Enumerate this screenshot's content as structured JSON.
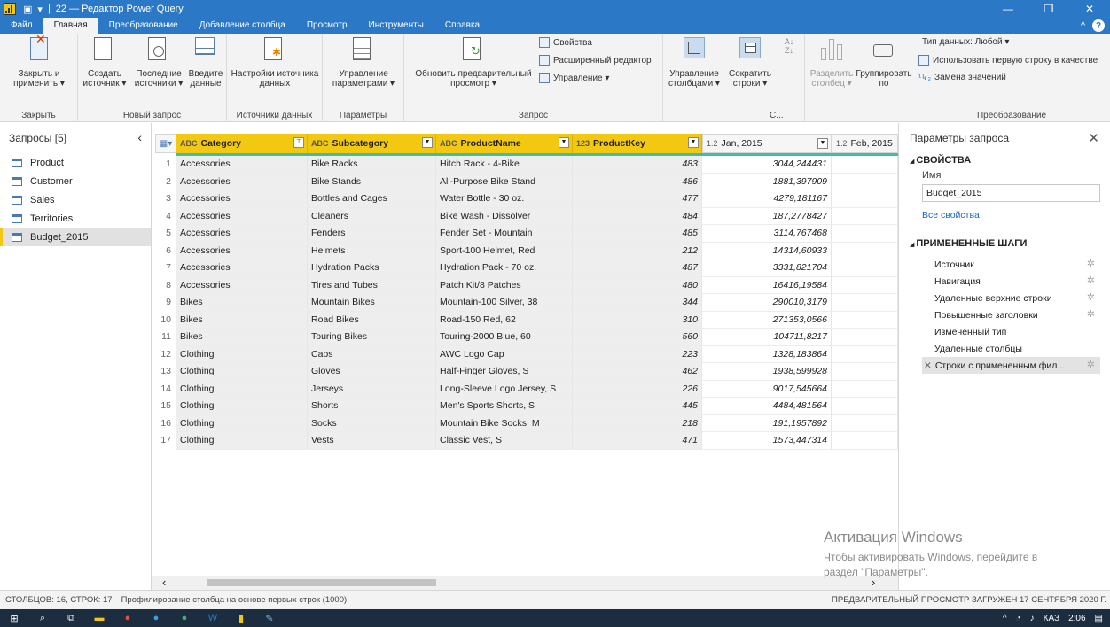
{
  "window": {
    "title": "22 — Редактор Power Query",
    "controls": [
      "—",
      "❐",
      "✕"
    ]
  },
  "menu_tabs": [
    "Файл",
    "Главная",
    "Преобразование",
    "Добавление столбца",
    "Просмотр",
    "Инструменты",
    "Справка"
  ],
  "ribbon": {
    "close_apply": "Закрыть и применить ▾",
    "close_group": "Закрыть",
    "new_source": "Создать источник ▾",
    "recent_sources": "Последние источники ▾",
    "enter_data": "Введите данные",
    "new_query_group": "Новый запрос",
    "datasource_settings": "Настройки источника данных",
    "datasources_group": "Источники данных",
    "manage_params": "Управление параметрами ▾",
    "params_group": "Параметры",
    "refresh_preview": "Обновить предварительный просмотр ▾",
    "properties": "Свойства",
    "advanced_editor": "Расширенный редактор",
    "manage": "Управление ▾",
    "query_group": "Запрос",
    "manage_columns": "Управление столбцами ▾",
    "reduce_rows": "Сократить строки ▾",
    "sort_group_label": "С...",
    "split_column": "Разделить столбец ▾",
    "group_by": "Группировать по",
    "data_type": "Тип данных: Любой ▾",
    "use_first_row": "Использовать первую строку в качестве",
    "replace_values": "Замена значений",
    "transform_group": "Преобразование"
  },
  "queries_panel": {
    "header": "Запросы [5]",
    "items": [
      "Product",
      "Customer",
      "Sales",
      "Territories",
      "Budget_2015"
    ],
    "selected": "Budget_2015"
  },
  "grid": {
    "columns": [
      {
        "type": "ABC",
        "name": "Category"
      },
      {
        "type": "ABC",
        "name": "Subcategory"
      },
      {
        "type": "ABC",
        "name": "ProductName"
      },
      {
        "type": "123",
        "name": "ProductKey"
      },
      {
        "type": "1.2",
        "name": "Jan, 2015"
      },
      {
        "type": "1.2",
        "name": "Feb, 2015"
      }
    ],
    "rows": [
      [
        "1",
        "Accessories",
        "Bike Racks",
        "Hitch Rack - 4-Bike",
        "483",
        "3044,244431"
      ],
      [
        "2",
        "Accessories",
        "Bike Stands",
        "All-Purpose Bike Stand",
        "486",
        "1881,397909"
      ],
      [
        "3",
        "Accessories",
        "Bottles and Cages",
        "Water Bottle - 30 oz.",
        "477",
        "4279,181167"
      ],
      [
        "4",
        "Accessories",
        "Cleaners",
        "Bike Wash - Dissolver",
        "484",
        "187,2778427"
      ],
      [
        "5",
        "Accessories",
        "Fenders",
        "Fender Set - Mountain",
        "485",
        "3114,767468"
      ],
      [
        "6",
        "Accessories",
        "Helmets",
        "Sport-100 Helmet, Red",
        "212",
        "14314,60933"
      ],
      [
        "7",
        "Accessories",
        "Hydration Packs",
        "Hydration Pack - 70 oz.",
        "487",
        "3331,821704"
      ],
      [
        "8",
        "Accessories",
        "Tires and Tubes",
        "Patch Kit/8 Patches",
        "480",
        "16416,19584"
      ],
      [
        "9",
        "Bikes",
        "Mountain Bikes",
        "Mountain-100 Silver, 38",
        "344",
        "290010,3179"
      ],
      [
        "10",
        "Bikes",
        "Road Bikes",
        "Road-150 Red, 62",
        "310",
        "271353,0566"
      ],
      [
        "11",
        "Bikes",
        "Touring Bikes",
        "Touring-2000 Blue, 60",
        "560",
        "104711,8217"
      ],
      [
        "12",
        "Clothing",
        "Caps",
        "AWC Logo Cap",
        "223",
        "1328,183864"
      ],
      [
        "13",
        "Clothing",
        "Gloves",
        "Half-Finger Gloves, S",
        "462",
        "1938,599928"
      ],
      [
        "14",
        "Clothing",
        "Jerseys",
        "Long-Sleeve Logo Jersey, S",
        "226",
        "9017,545664"
      ],
      [
        "15",
        "Clothing",
        "Shorts",
        "Men's Sports Shorts, S",
        "445",
        "4484,481564"
      ],
      [
        "16",
        "Clothing",
        "Socks",
        "Mountain Bike Socks, M",
        "218",
        "191,1957892"
      ],
      [
        "17",
        "Clothing",
        "Vests",
        "Classic Vest, S",
        "471",
        "1573,447314"
      ]
    ]
  },
  "settings_panel": {
    "header": "Параметры запроса",
    "properties_section": "СВОЙСТВА",
    "name_label": "Имя",
    "name_value": "Budget_2015",
    "all_properties": "Все свойства",
    "steps_section": "ПРИМЕНЕННЫЕ ШАГИ",
    "steps": [
      "Источник",
      "Навигация",
      "Удаленные верхние строки",
      "Повышенные заголовки",
      "Измененный тип",
      "Удаленные столбцы",
      "Строки с примененным фил..."
    ]
  },
  "watermark": {
    "line1": "Активация Windows",
    "line2": "Чтобы активировать Windows, перейдите в",
    "line3": "раздел \"Параметры\"."
  },
  "status": {
    "left": "СТОЛБЦОВ: 16, СТРОК: 17",
    "profiling": "Профилирование столбца на основе первых строк (1000)",
    "right": "ПРЕДВАРИТЕЛЬНЫЙ ПРОСМОТР ЗАГРУЖЕН 17 СЕНТЯБРЯ 2020 Г."
  },
  "taskbar": {
    "lang": "КАЗ",
    "time": "2:06"
  },
  "colors": {
    "titlebar": "#2b78c6",
    "column_header": "#f2c811",
    "quality_bar": "#3dbfa6",
    "taskbar": "#1c2d3f"
  }
}
